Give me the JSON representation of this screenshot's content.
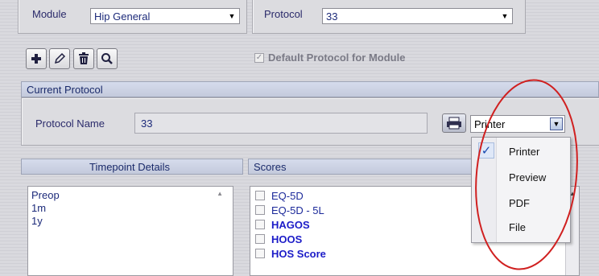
{
  "module": {
    "label": "Module",
    "value": "Hip General"
  },
  "protocol": {
    "label": "Protocol",
    "value": "33"
  },
  "default_checkbox": {
    "label": "Default Protocol for Module",
    "checked": true
  },
  "current_protocol": {
    "header": "Current Protocol",
    "name_label": "Protocol Name",
    "name_value": "33",
    "output_select_value": "Printer"
  },
  "output_menu": {
    "items": [
      {
        "label": "Printer",
        "checked": true
      },
      {
        "label": "Preview",
        "checked": false
      },
      {
        "label": "PDF",
        "checked": false
      },
      {
        "label": "File",
        "checked": false
      }
    ]
  },
  "timepoints": {
    "header": "Timepoint Details",
    "items": [
      "Preop",
      "1m",
      "1y"
    ]
  },
  "scores": {
    "header": "Scores",
    "items": [
      {
        "label": "EQ-5D",
        "bold": false
      },
      {
        "label": "EQ-5D - 5L",
        "bold": false
      },
      {
        "label": "HAGOS",
        "bold": true
      },
      {
        "label": "HOOS",
        "bold": true
      },
      {
        "label": "HOS Score",
        "bold": true
      }
    ]
  },
  "colors": {
    "highlight_ring": "#d02020",
    "accent_text": "#1c1cc8"
  }
}
